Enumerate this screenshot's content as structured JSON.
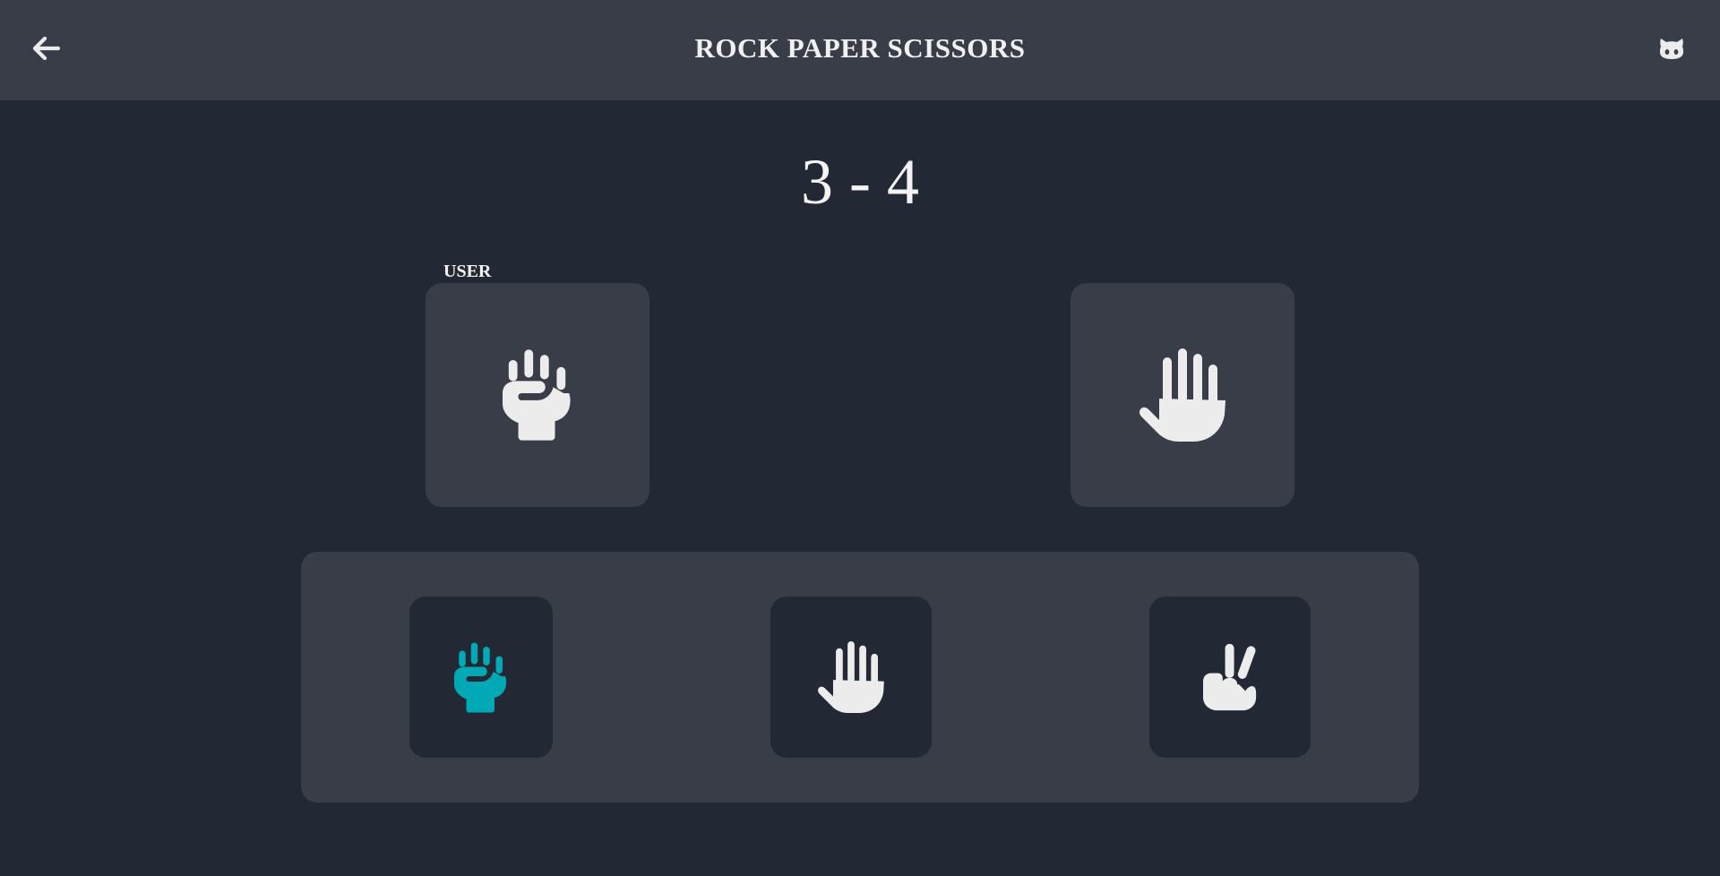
{
  "header": {
    "title": "ROCK PAPER SCISSORS",
    "back_icon": "arrow-left-icon",
    "github_icon": "github-icon"
  },
  "score": {
    "text": "3 - 4",
    "user": 3,
    "computer": 4
  },
  "players": {
    "user_label": "USER",
    "user_choice": "rock",
    "computer_choice": "paper"
  },
  "choices": [
    {
      "id": "rock",
      "icon": "hand-rock-icon",
      "selected": true
    },
    {
      "id": "paper",
      "icon": "hand-paper-icon",
      "selected": false
    },
    {
      "id": "scissors",
      "icon": "hand-scissors-icon",
      "selected": false
    }
  ],
  "colors": {
    "background": "#222834",
    "panel": "#393d48",
    "icon": "#ececec",
    "selected": "#00a9b5"
  }
}
